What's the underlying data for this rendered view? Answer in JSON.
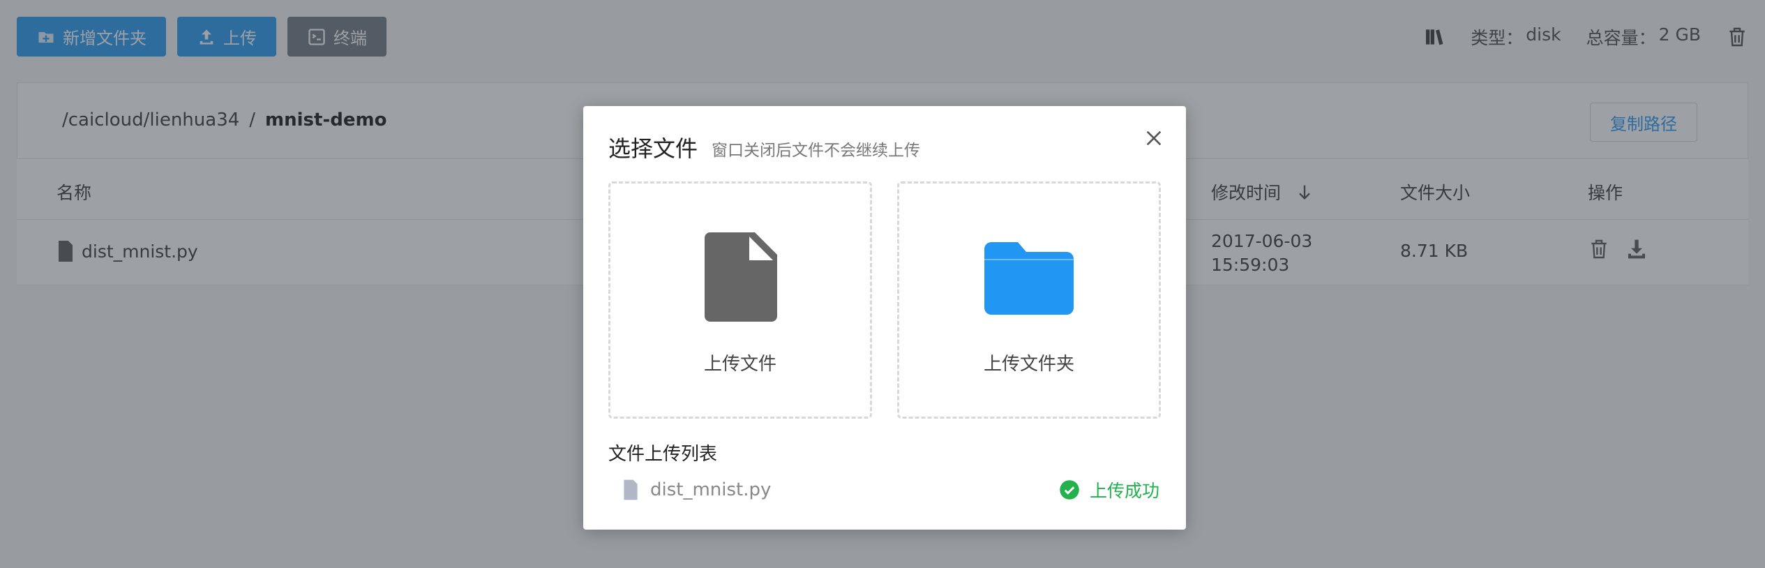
{
  "toolbar": {
    "new_folder": "新增文件夹",
    "upload": "上传",
    "terminal": "终端"
  },
  "storage": {
    "type_label": "类型：",
    "type_value": "disk",
    "capacity_label": "总容量：",
    "capacity_value": "2 GB"
  },
  "breadcrumb": {
    "parent": "/caicloud/lienhua34",
    "separator": "/",
    "current": "mnist-demo",
    "copy_label": "复制路径"
  },
  "table": {
    "headers": {
      "name": "名称",
      "modified": "修改时间",
      "size": "文件大小",
      "ops": "操作"
    },
    "rows": [
      {
        "name": "dist_mnist.py",
        "date": "2017-06-03",
        "time": "15:59:03",
        "size": "8.71 KB"
      }
    ]
  },
  "modal": {
    "title": "选择文件",
    "subtitle": "窗口关闭后文件不会继续上传",
    "upload_file": "上传文件",
    "upload_folder": "上传文件夹",
    "list_title": "文件上传列表",
    "items": [
      {
        "name": "dist_mnist.py",
        "status": "上传成功"
      }
    ]
  },
  "colors": {
    "primary": "#2196f3",
    "success": "#22b14c",
    "file_icon": "#666666",
    "folder_icon": "#2196f3"
  }
}
